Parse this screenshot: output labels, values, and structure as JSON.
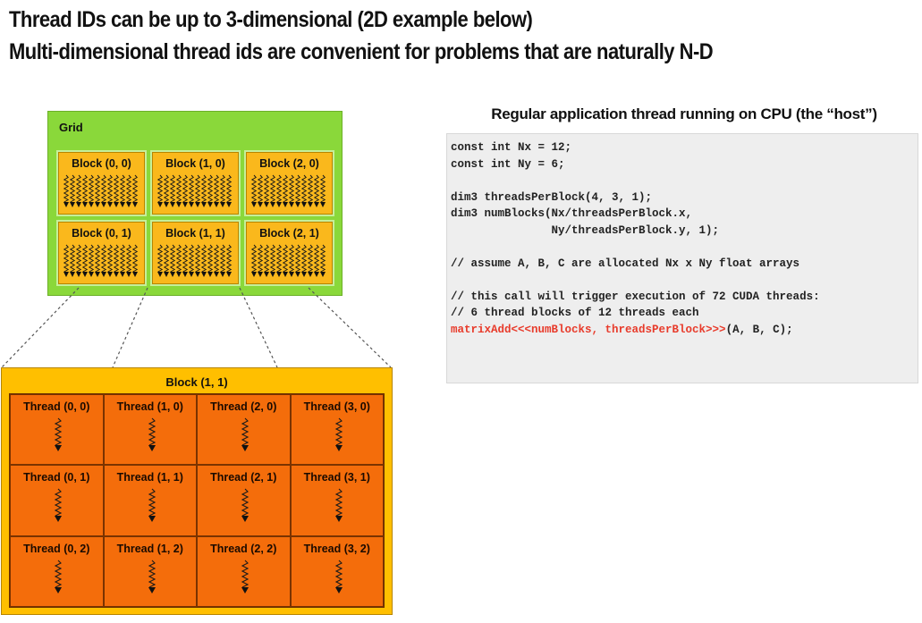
{
  "heading": {
    "line1": "Thread IDs can be up to 3-dimensional (2D example below)",
    "line2": "Multi-dimensional thread ids are convenient for problems that are naturally N-D"
  },
  "grid": {
    "label": "Grid",
    "blocks": [
      "Block (0, 0)",
      "Block (1, 0)",
      "Block (2, 0)",
      "Block (0, 1)",
      "Block (1, 1)",
      "Block (2, 1)"
    ]
  },
  "expanded_block": {
    "label": "Block (1, 1)",
    "threads": [
      "Thread (0, 0)",
      "Thread (1, 0)",
      "Thread (2, 0)",
      "Thread (3, 0)",
      "Thread (0, 1)",
      "Thread (1, 1)",
      "Thread (2, 1)",
      "Thread (3, 1)",
      "Thread (0, 2)",
      "Thread (1, 2)",
      "Thread (2, 2)",
      "Thread (3, 2)"
    ]
  },
  "code": {
    "title": "Regular application thread running on CPU (the “host”)",
    "lines": [
      "const int Nx = 12;",
      "const int Ny = 6;",
      "",
      "dim3 threadsPerBlock(4, 3, 1);",
      "dim3 numBlocks(Nx/threadsPerBlock.x,",
      "               Ny/threadsPerBlock.y, 1);",
      "",
      "// assume A, B, C are allocated Nx x Ny float arrays",
      "",
      "// this call will trigger execution of 72 CUDA threads:",
      "// 6 thread blocks of 12 threads each"
    ],
    "launch_kernel": "matrixAdd<<<numBlocks, threadsPerBlock>>>",
    "launch_args": "(A, B, C);"
  },
  "colors": {
    "grid_bg": "#8ad83a",
    "block_bg": "#fab81c",
    "thread_bg": "#f46d0b",
    "kernel_launch": "#e83b2b"
  }
}
